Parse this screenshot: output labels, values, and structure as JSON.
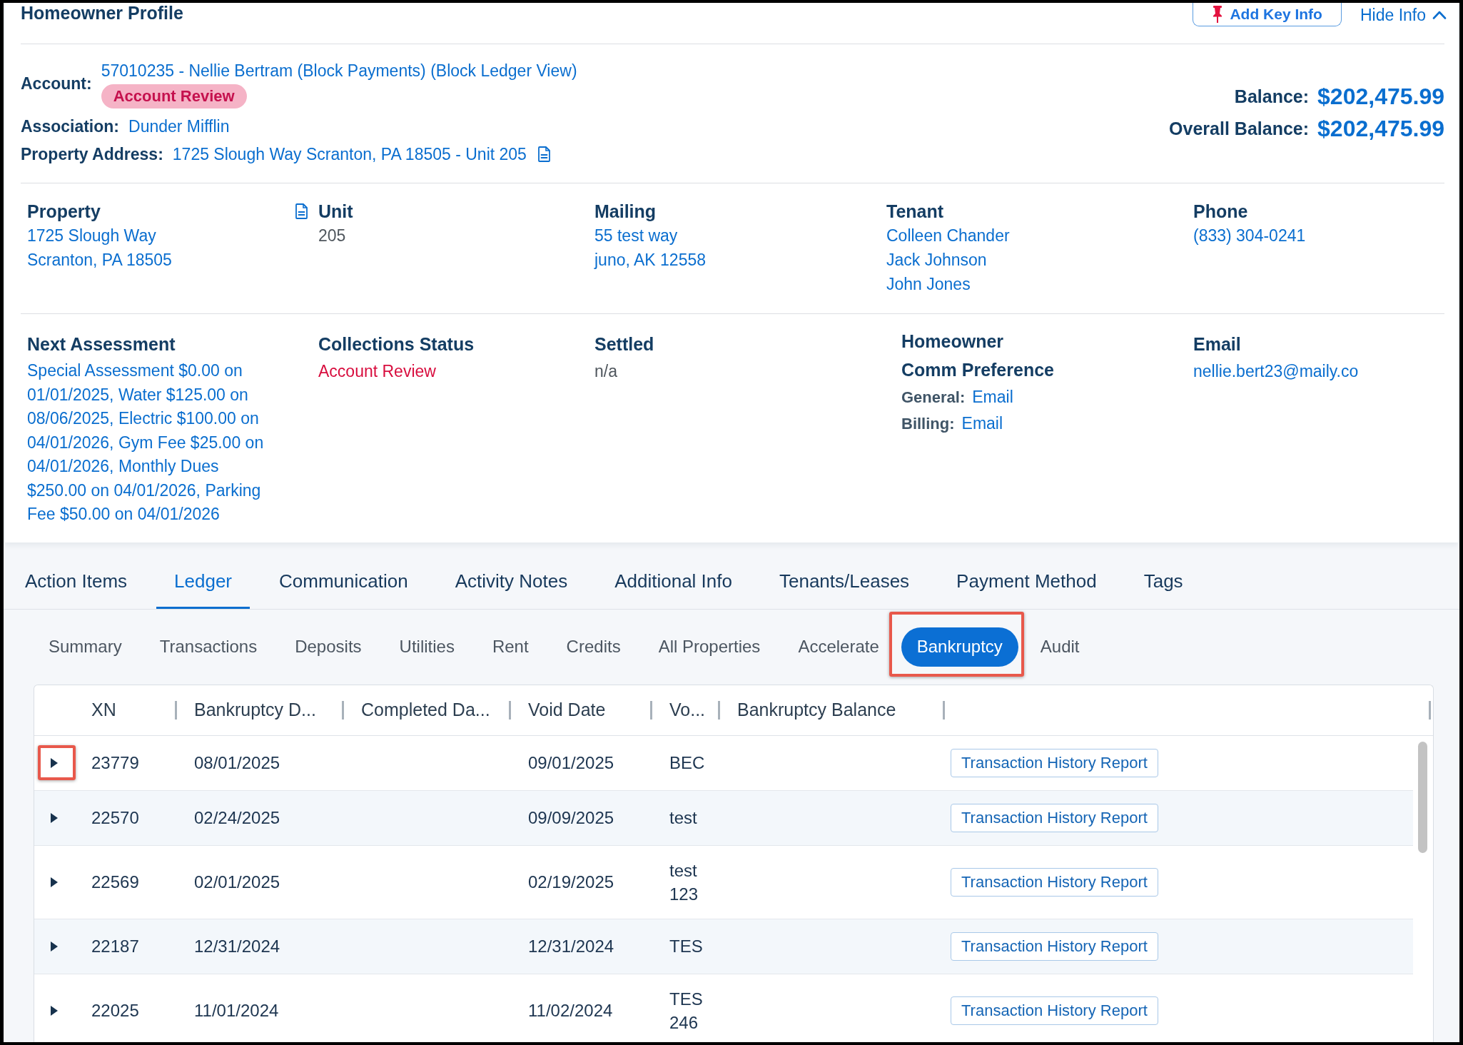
{
  "profile": {
    "title": "Homeowner Profile",
    "add_key_info_button": "Add Key Info",
    "hide_info_link": "Hide Info",
    "account": {
      "label": "Account:",
      "value": "57010235 - Nellie Bertram (Block Payments) (Block Ledger View)",
      "status_badge": "Account Review"
    },
    "association": {
      "label": "Association:",
      "value": "Dunder Mifflin"
    },
    "property_address": {
      "label": "Property Address:",
      "value": "1725 Slough Way Scranton, PA 18505 - Unit 205",
      "document_icon": true
    },
    "balances": [
      {
        "label": "Balance:",
        "value": "$202,475.99"
      },
      {
        "label": "Overall Balance:",
        "value": "$202,475.99"
      }
    ]
  },
  "details": [
    [
      {
        "kind": "links",
        "heading": "Property",
        "lines": [
          "1725 Slough Way",
          "Scranton, PA 18505"
        ],
        "document_icon": true
      },
      {
        "kind": "plain",
        "heading": "Unit",
        "lines": [
          "205"
        ]
      },
      {
        "kind": "links",
        "heading": "Mailing",
        "lines": [
          "55 test way",
          "juno, AK 12558"
        ]
      },
      {
        "kind": "links",
        "heading": "Tenant",
        "lines": [
          "Colleen Chander",
          "Jack Johnson",
          "John Jones"
        ]
      },
      {
        "kind": "links",
        "heading": "Phone",
        "lines": [
          "(833) 304-0241"
        ]
      }
    ],
    [
      {
        "kind": "paragraph",
        "heading": "Next Assessment",
        "lines": [
          "Special Assessment $0.00 on 01/01/2025, Water $125.00 on 08/06/2025, Electric $100.00 on 04/01/2026, Gym Fee $25.00 on 04/01/2026, Monthly Dues $250.00 on 04/01/2026, Parking Fee $50.00 on 04/01/2026"
        ]
      },
      {
        "kind": "alert",
        "heading": "Collections Status",
        "lines": [
          "Account Review"
        ]
      },
      {
        "kind": "plain",
        "heading": "Settled",
        "lines": [
          "n/a"
        ]
      },
      {
        "kind": "preferences",
        "heading_lines": [
          "Homeowner",
          "Comm Preference"
        ],
        "pairs": [
          {
            "label": "General:",
            "value": "Email"
          },
          {
            "label": "Billing:",
            "value": "Email"
          }
        ]
      },
      {
        "kind": "links",
        "heading": "Email",
        "lines": [
          "nellie.bert23@maily.co"
        ]
      }
    ]
  ],
  "tabs": [
    {
      "label": "Action Items",
      "selected": false
    },
    {
      "label": "Ledger",
      "selected": true
    },
    {
      "label": "Communication",
      "selected": false
    },
    {
      "label": "Activity Notes",
      "selected": false
    },
    {
      "label": "Additional Info",
      "selected": false
    },
    {
      "label": "Tenants/Leases",
      "selected": false
    },
    {
      "label": "Payment Method",
      "selected": false
    },
    {
      "label": "Tags",
      "selected": false
    }
  ],
  "subtabs": [
    {
      "label": "Summary",
      "selected": false,
      "highlighted": false
    },
    {
      "label": "Transactions",
      "selected": false,
      "highlighted": false
    },
    {
      "label": "Deposits",
      "selected": false,
      "highlighted": false
    },
    {
      "label": "Utilities",
      "selected": false,
      "highlighted": false
    },
    {
      "label": "Rent",
      "selected": false,
      "highlighted": false
    },
    {
      "label": "Credits",
      "selected": false,
      "highlighted": false
    },
    {
      "label": "All Properties",
      "selected": false,
      "highlighted": false
    },
    {
      "label": "Accelerate",
      "selected": false,
      "highlighted": false
    },
    {
      "label": "Bankruptcy",
      "selected": true,
      "highlighted": true
    },
    {
      "label": "Audit",
      "selected": false,
      "highlighted": false
    }
  ],
  "table": {
    "columns": [
      "XN",
      "Bankruptcy D...",
      "Completed Da...",
      "Void Date",
      "Vo...",
      "Bankruptcy Balance"
    ],
    "rows": [
      {
        "expanded": false,
        "expander_highlighted": true,
        "xn": "23779",
        "column_2": "08/01/2025",
        "void_date": "09/01/2025",
        "column_5": "BEC",
        "report_button": "Transaction History Report"
      },
      {
        "expanded": false,
        "expander_highlighted": false,
        "xn": "22570",
        "column_2": "02/24/2025",
        "void_date": "09/09/2025",
        "column_5": "test",
        "report_button": "Transaction History Report"
      },
      {
        "expanded": false,
        "expander_highlighted": false,
        "xn": "22569",
        "column_2": "02/01/2025",
        "void_date": "02/19/2025",
        "column_5": "test 123",
        "report_button": "Transaction History Report"
      },
      {
        "expanded": false,
        "expander_highlighted": false,
        "xn": "22187",
        "column_2": "12/31/2024",
        "void_date": "12/31/2024",
        "column_5": "TES",
        "report_button": "Transaction History Report"
      },
      {
        "expanded": false,
        "expander_highlighted": false,
        "xn": "22025",
        "column_2": "11/01/2024",
        "void_date": "11/02/2024",
        "column_5": "TES 246",
        "report_button": "Transaction History Report"
      }
    ]
  }
}
